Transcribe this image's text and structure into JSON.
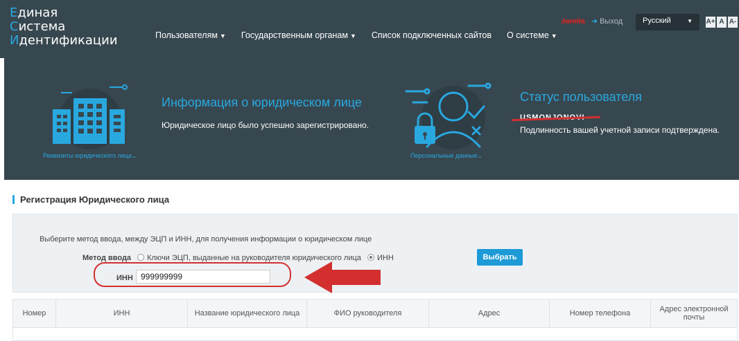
{
  "header": {
    "logo_lines": [
      {
        "cap": "Е",
        "rest": "диная"
      },
      {
        "cap": "С",
        "rest": "истема"
      },
      {
        "cap": "И",
        "rest": "дентификации"
      }
    ],
    "nav": [
      {
        "label": "Пользователям",
        "dropdown": true
      },
      {
        "label": "Государственным органам",
        "dropdown": true
      },
      {
        "label": "Список подключенных сайтов",
        "dropdown": false
      },
      {
        "label": "О системе",
        "dropdown": true
      }
    ],
    "user_name": "Jamila",
    "logout_label": "Выход",
    "language": "Русский",
    "font_buttons": [
      "A+",
      "A",
      "A-"
    ]
  },
  "banner": {
    "requisites_link": "Реквизиты юридического лица",
    "legal_title": "Информация о юридическом лице",
    "legal_text": "Юридическое лицо было успешно зарегистрировано.",
    "personal_link": "Персональные данные",
    "status_title": "Статус пользователя",
    "username": "USMONJONOVI",
    "status_text": "Подлинность вашей учетной записи подтверждена."
  },
  "form": {
    "section_title": "Регистрация Юридического лица",
    "hint": "Выберите метод ввода, между ЭЦП и ИНН, для получения информации о юридическом лице",
    "method_label": "Метод ввода",
    "options": [
      {
        "label": "Ключи ЭЦП, выданные на руководителя юридического лица",
        "checked": false
      },
      {
        "label": "ИНН",
        "checked": true
      }
    ],
    "select_button": "Выбрать",
    "inn_label": "ИНН",
    "inn_value": "999999999"
  },
  "table": {
    "columns": [
      "Номер",
      "ИНН",
      "Название юридического лица",
      "ФИО руководителя",
      "Адрес",
      "Номер телефона",
      "Адрес электронной почты"
    ]
  },
  "colors": {
    "header_bg": "#37474f",
    "accent": "#29a8e0",
    "button": "#1e9bd7",
    "annotation_red": "#d32f2f"
  }
}
